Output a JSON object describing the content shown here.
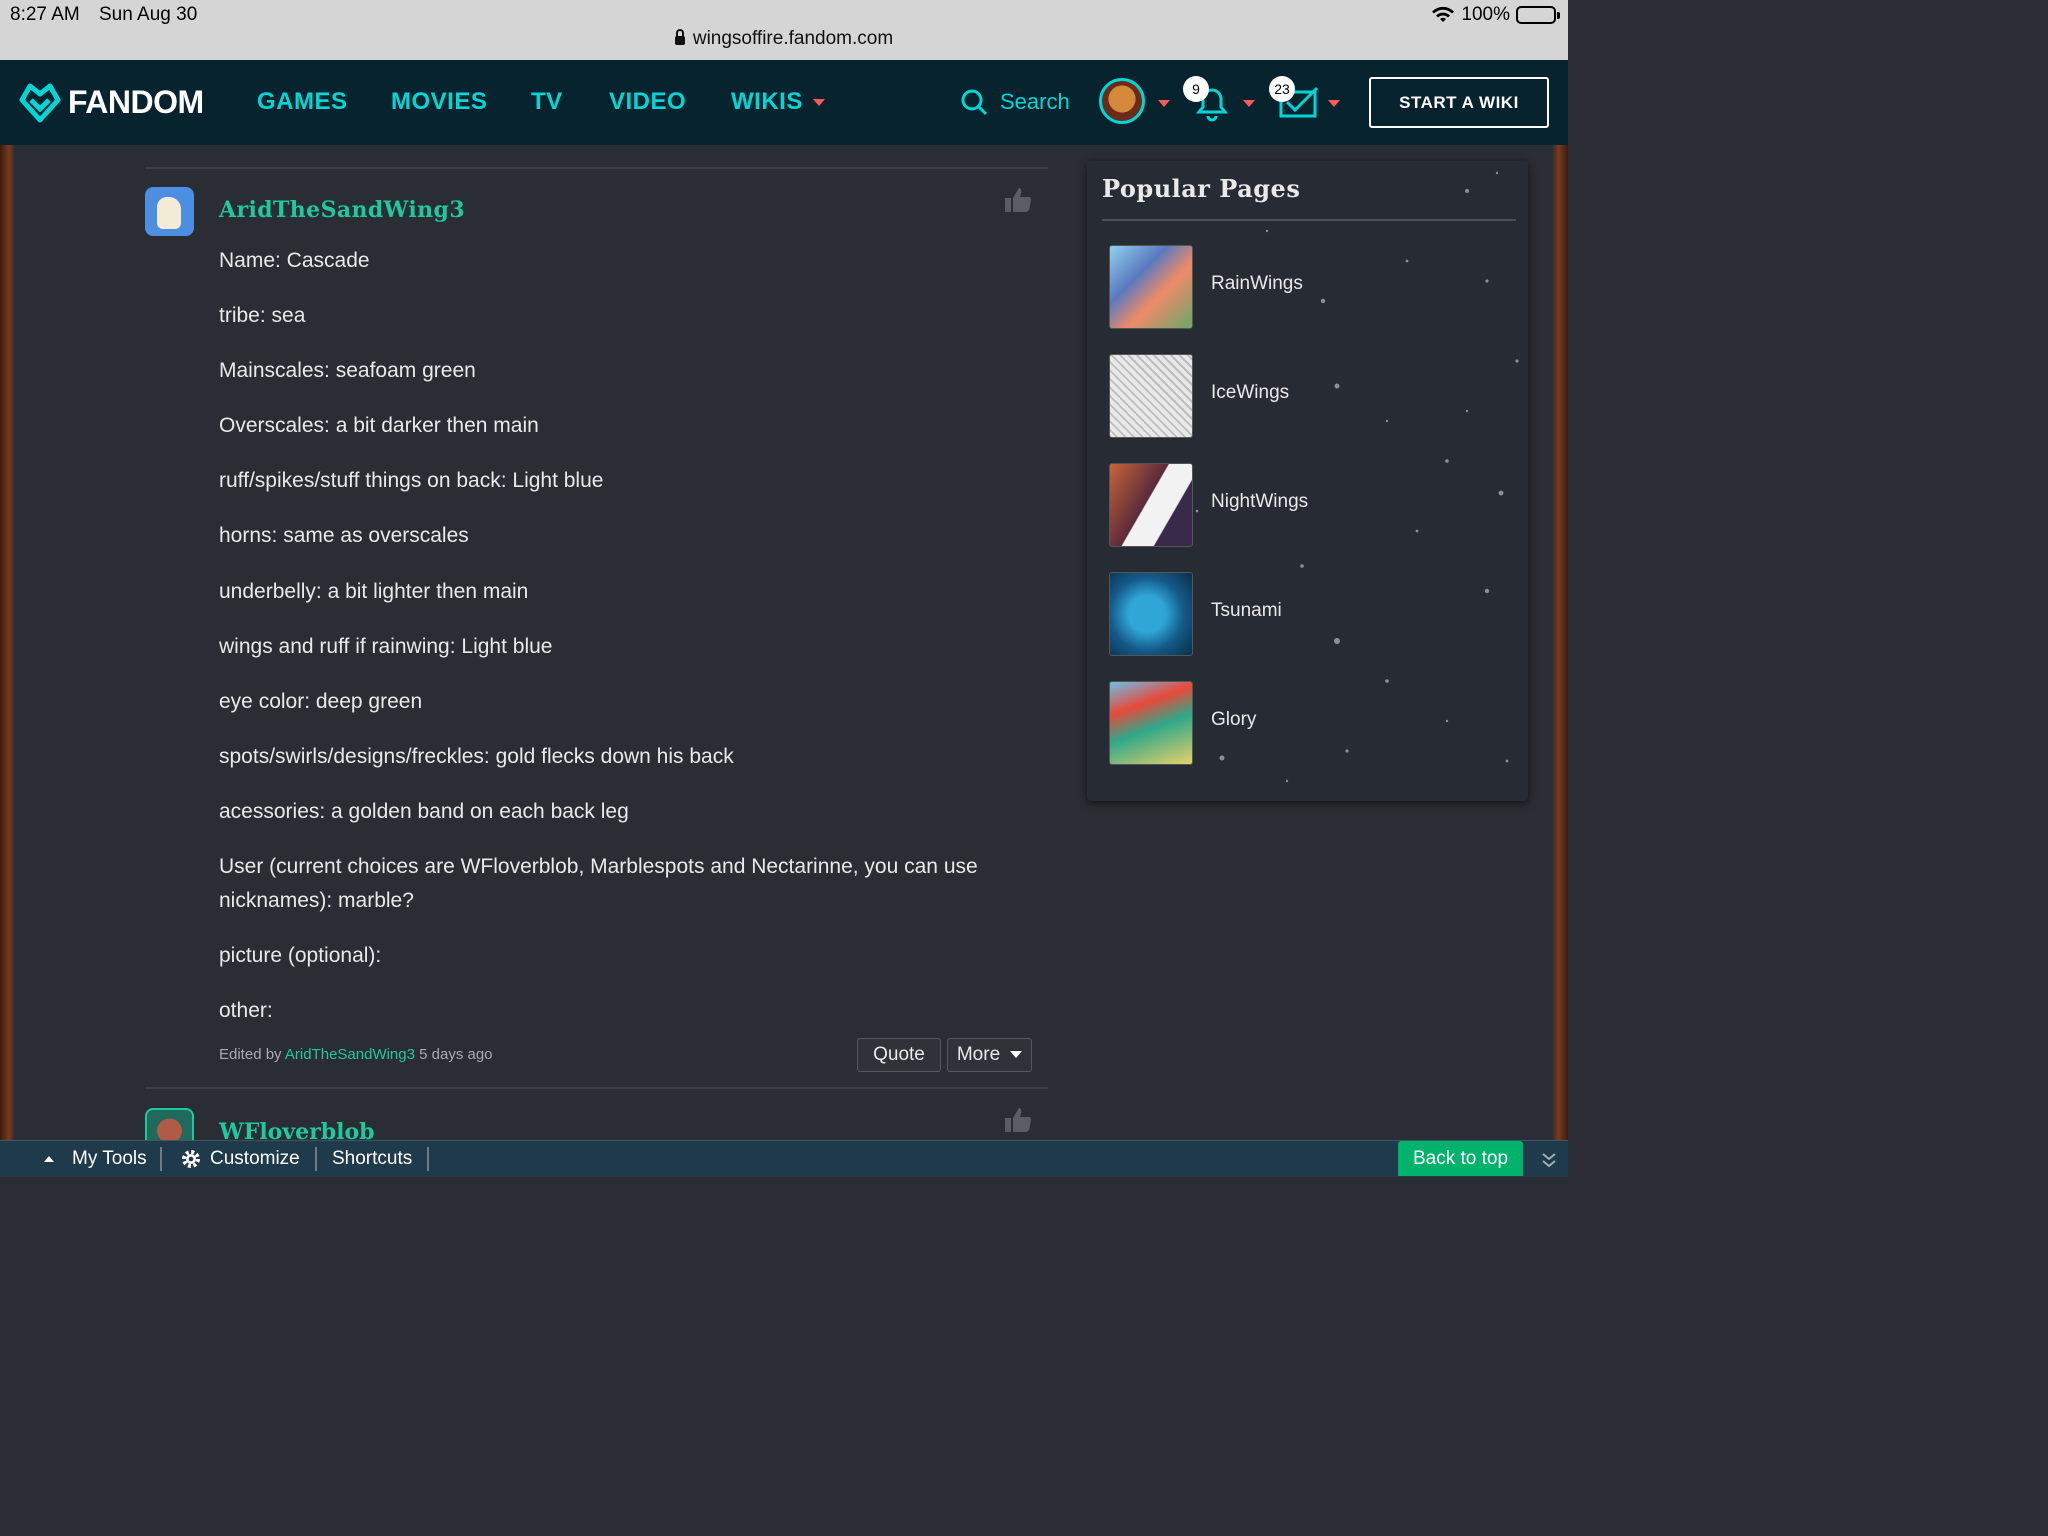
{
  "status_bar": {
    "time": "8:27 AM",
    "date": "Sun Aug 30",
    "battery": "100%"
  },
  "url_bar": {
    "domain": "wingsoffire.fandom.com"
  },
  "nav": {
    "logo": "FANDOM",
    "links": [
      "GAMES",
      "MOVIES",
      "TV",
      "VIDEO",
      "WIKIS"
    ],
    "search_label": "Search",
    "notifications_count": "9",
    "messages_count": "23",
    "start_wiki": "START A WIKI",
    "accent_color": "#00d6d6"
  },
  "comment": {
    "author": "AridTheSandWing3",
    "lines": [
      "Name: Cascade",
      "tribe: sea",
      "Mainscales: seafoam green",
      "Overscales: a bit darker then main",
      "ruff/spikes/stuff things on back: Light blue",
      "horns: same as overscales",
      "underbelly: a bit lighter then main",
      "wings and ruff if rainwing: Light blue",
      "eye color: deep green",
      "spots/swirls/designs/freckles: gold flecks down his back",
      "acessories: a golden band on each back leg",
      "User (current choices are WFloverblob, Marblespots and Nectarinne, you can use",
      "nicknames): marble?",
      "picture (optional):",
      "other:"
    ],
    "edited_prefix": "Edited by",
    "edited_by": "AridTheSandWing3",
    "edited_when": "5 days ago",
    "quote_button": "Quote",
    "more_button": "More"
  },
  "next_comment": {
    "author": "WFloverblob"
  },
  "popular_pages": {
    "title": "Popular Pages",
    "items": [
      {
        "label": "RainWings"
      },
      {
        "label": "IceWings"
      },
      {
        "label": "NightWings"
      },
      {
        "label": "Tsunami"
      },
      {
        "label": "Glory"
      }
    ]
  },
  "toolbar": {
    "my_tools": "My Tools",
    "customize": "Customize",
    "shortcuts": "Shortcuts",
    "back_to_top": "Back to top"
  }
}
